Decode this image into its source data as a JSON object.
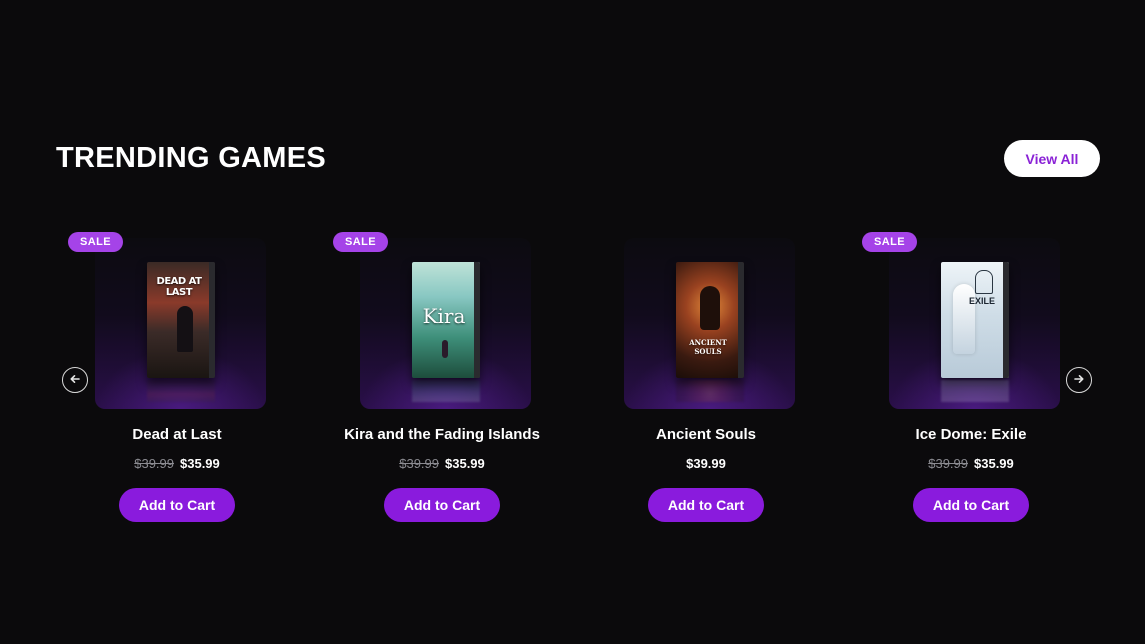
{
  "section": {
    "title": "TRENDING GAMES",
    "view_all_label": "View All"
  },
  "carousel": {
    "prev_icon": "arrow-left-icon",
    "next_icon": "arrow-right-icon"
  },
  "colors": {
    "background": "#0b0a0c",
    "accent": "#8a1bdd",
    "sale_badge": "#a543e8",
    "view_all_text": "#8a22d6"
  },
  "cart_label": "Add to Cart",
  "products": [
    {
      "name": "Dead at Last",
      "badge": "SALE",
      "old_price": "$39.99",
      "price": "$35.99",
      "box_title": "DEAD AT LAST"
    },
    {
      "name": "Kira and the Fading Islands",
      "badge": "SALE",
      "old_price": "$39.99",
      "price": "$35.99",
      "box_title": "Kira"
    },
    {
      "name": "Ancient Souls",
      "badge": "",
      "old_price": "",
      "price": "$39.99",
      "box_title": "ANCIENT SOULS"
    },
    {
      "name": "Ice Dome: Exile",
      "badge": "SALE",
      "old_price": "$39.99",
      "price": "$35.99",
      "box_title": "EXILE"
    }
  ]
}
